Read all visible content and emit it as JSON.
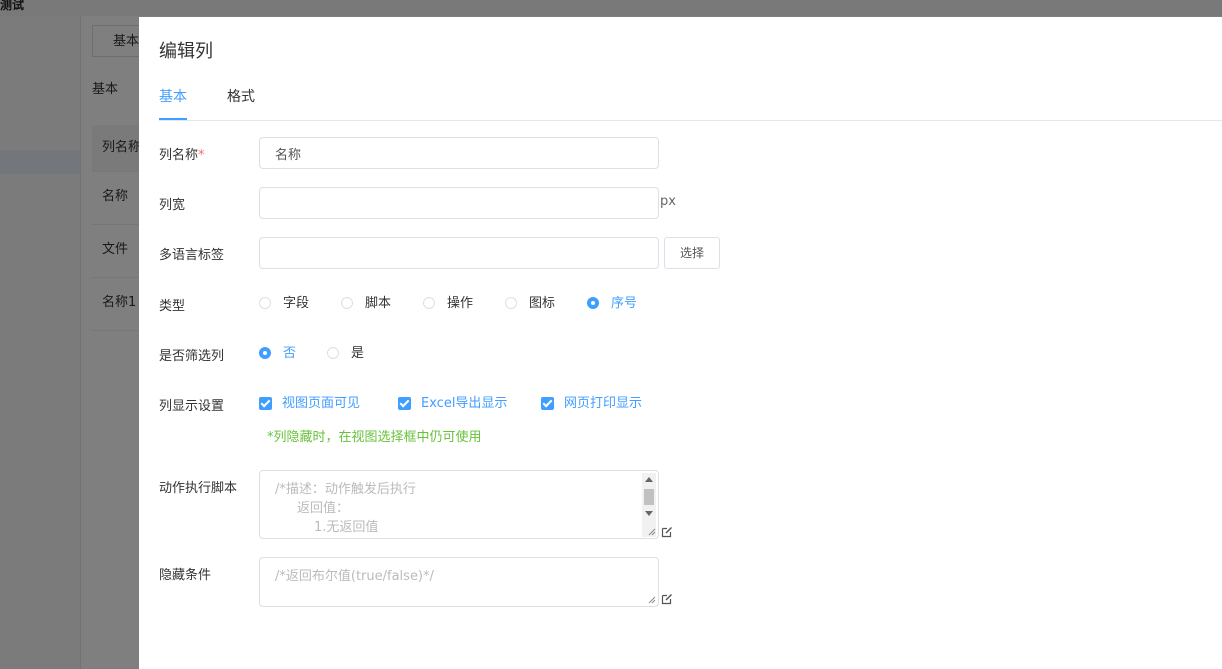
{
  "background": {
    "breadcrumb": "测试",
    "tab_label": "基本",
    "section_label": "基本",
    "rows": [
      "列名称",
      "名称",
      "文件",
      "名称1"
    ]
  },
  "dialog": {
    "title": "编辑列",
    "tabs": [
      {
        "label": "基本",
        "active": true
      },
      {
        "label": "格式",
        "active": false
      }
    ],
    "fields": {
      "column_name": {
        "label": "列名称",
        "required_mark": "*",
        "value": "名称"
      },
      "column_width": {
        "label": "列宽",
        "value": "",
        "suffix": "px"
      },
      "i18n_label": {
        "label": "多语言标签",
        "value": "",
        "button": "选择"
      },
      "type": {
        "label": "类型",
        "options": [
          "字段",
          "脚本",
          "操作",
          "图标",
          "序号"
        ],
        "selected": "序号"
      },
      "is_filter": {
        "label": "是否筛选列",
        "options": [
          "否",
          "是"
        ],
        "selected": "否"
      },
      "display": {
        "label": "列显示设置",
        "options": [
          "视图页面可见",
          "Excel导出显示",
          "网页打印显示"
        ],
        "checked": [
          true,
          true,
          true
        ],
        "hint": "*列隐藏时，在视图选择框中仍可使用"
      },
      "action_script": {
        "label": "动作执行脚本",
        "lines": [
          "/*描述：动作触发后执行",
          "返回值：",
          "1.无返回值"
        ]
      },
      "hide_condition": {
        "label": "隐藏条件",
        "placeholder": "/*返回布尔值(true/false)*/"
      }
    }
  },
  "colors": {
    "primary": "#409eff",
    "required": "#f56c6c",
    "hint": "#67c23a"
  }
}
